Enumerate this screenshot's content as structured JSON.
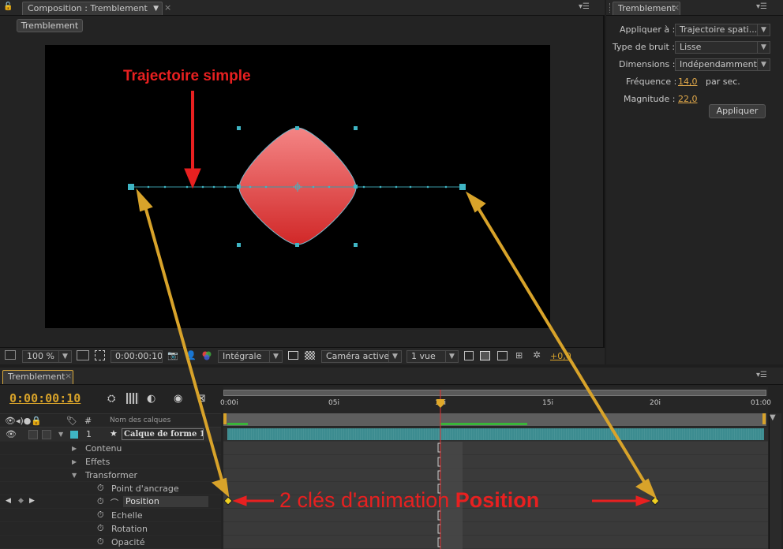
{
  "composition": {
    "tab_label": "Composition : Tremblement",
    "subtab": "Tremblement",
    "annotation": "Trajectoire simple",
    "toolbar": {
      "zoom": "100 %",
      "timecode": "0:00:00:10",
      "resolution": "Intégrale",
      "camera": "Caméra active",
      "views": "1 vue",
      "exposure": "+0,0"
    }
  },
  "wiggler": {
    "tab_label": "Tremblement",
    "apply_to_label": "Appliquer à :",
    "apply_to_value": "Trajectoire spati...",
    "noise_label": "Type de bruit :",
    "noise_value": "Lisse",
    "dimensions_label": "Dimensions :",
    "dimensions_value": "Indépendamment",
    "frequency_label": "Fréquence :",
    "frequency_value": "14,0",
    "frequency_unit": "par sec.",
    "magnitude_label": "Magnitude :",
    "magnitude_value": "22,0",
    "apply_button": "Appliquer"
  },
  "timeline": {
    "tab_label": "Tremblement",
    "current_time": "0:00:00:10",
    "col_hash": "#",
    "col_layer_name": "Nom des calques",
    "ruler": [
      "0:00i",
      "05i",
      "10i",
      "15i",
      "20i",
      "01:00"
    ],
    "layer": {
      "number": "1",
      "name": "Calque de forme 1"
    },
    "props": [
      {
        "name": "Contenu"
      },
      {
        "name": "Effets"
      },
      {
        "name": "Transformer"
      },
      {
        "name": "Point d'ancrage"
      },
      {
        "name": "Position"
      },
      {
        "name": "Echelle"
      },
      {
        "name": "Rotation"
      },
      {
        "name": "Opacité"
      }
    ],
    "annotation_prefix": "2 clés d'animation ",
    "annotation_bold": "Position"
  },
  "colors": {
    "accent": "#d8a32a",
    "annotation_red": "#e82020",
    "layer_bar": "#3c8c90",
    "shape_top": "#f37a7a",
    "shape_bottom": "#d42a2a"
  }
}
